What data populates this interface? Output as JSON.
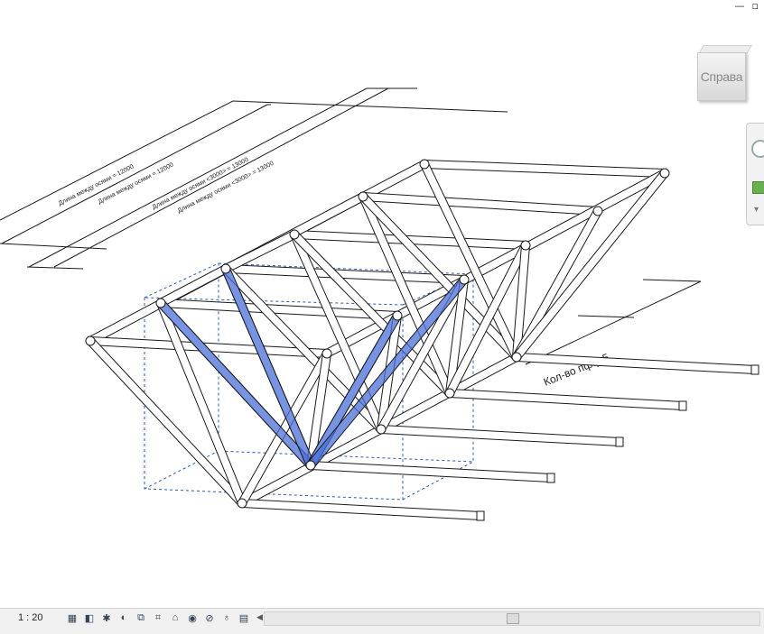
{
  "viewcube": {
    "face_label": "Справа"
  },
  "window_controls": {
    "minimize": "—",
    "close": "▫"
  },
  "annotations": {
    "dim1": "Длина между осями = 12000",
    "dim2": "Длина между осями = 12000",
    "dim3": "Длина между осями <3000> = 13000",
    "dim4": "Длина между осями <3000> = 13000",
    "count_label": "Кол-во пфф 5"
  },
  "statusbar": {
    "scale": "1 : 20",
    "icons": [
      "detail-level-icon",
      "visual-style-icon",
      "sun-path-icon",
      "shadows-icon",
      "crop-view-icon",
      "show-crop-icon",
      "temporary-hide-icon",
      "reveal-hidden-icon",
      "analytical-model-icon",
      "highlight-icon",
      "worksharing-icon"
    ],
    "scroll_left": "◀"
  },
  "colors": {
    "highlight": "#4a6fd8",
    "line": "#1a1a1a",
    "section_box": "#2a5db0",
    "viewcube_text": "#8a8a8a"
  }
}
